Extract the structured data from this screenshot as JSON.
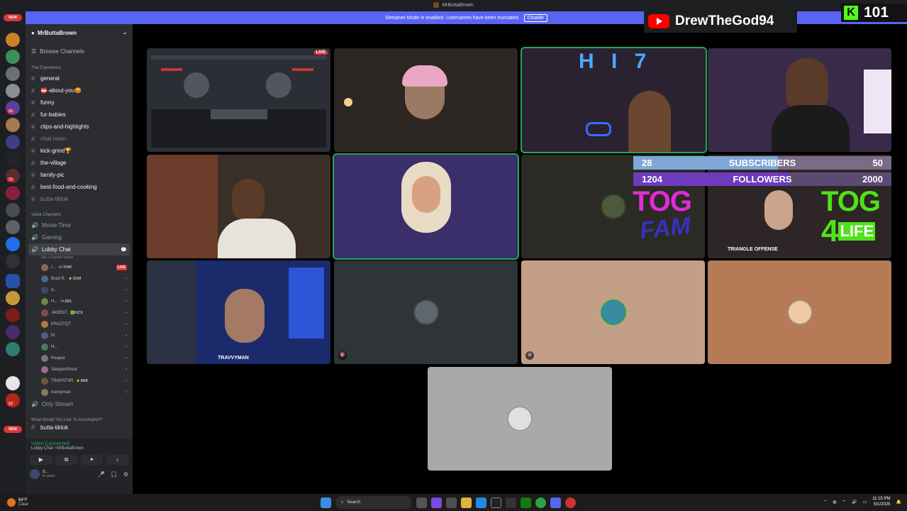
{
  "window": {
    "title": "MrButtaBrown",
    "controls": [
      "▭",
      "—",
      "▢",
      "✕"
    ]
  },
  "banner": {
    "text": "Streamer Mode is enabled. Usernames have been truncated.",
    "button": "Disable"
  },
  "guild_rail": {
    "new_badge_top": "NEW",
    "new_badge_bottom": "NEW",
    "counts": [
      "33",
      "71",
      "17"
    ]
  },
  "server": {
    "name": "MrButtaBrown",
    "browse": "Browse Channels"
  },
  "categories": {
    "experience": "The Experience",
    "voice": "Voice Channels",
    "accomplish": "What Would You Like To Accomplish?"
  },
  "text_channels": [
    {
      "name": "general",
      "muted": false
    },
    {
      "name": "📛-about-you😡",
      "muted": false
    },
    {
      "name": "funny",
      "muted": false
    },
    {
      "name": "fur-babies",
      "muted": false
    },
    {
      "name": "clips-and-highlights",
      "muted": false
    },
    {
      "name": "chat-room",
      "muted": true
    },
    {
      "name": "kick-grind🏆",
      "muted": false
    },
    {
      "name": "the-village",
      "muted": false
    },
    {
      "name": "family-pic",
      "muted": false
    },
    {
      "name": "best-food-and-cooking",
      "muted": false
    },
    {
      "name": "butta-tiktok",
      "muted": true
    }
  ],
  "voice_channels": [
    {
      "name": "Movie Time"
    },
    {
      "name": "Gaming"
    },
    {
      "name": "Lobby Chat",
      "status": "Set a channel status"
    }
  ],
  "voice_members": [
    {
      "name": "I...",
      "tag": "🎮THAT",
      "live": "LIVE"
    },
    {
      "name": "Brad R.",
      "tag": "⚡DOM",
      "live": ""
    },
    {
      "name": "d...",
      "tag": "",
      "live": ""
    },
    {
      "name": "H...",
      "tag": "🎮DRL",
      "live": ""
    },
    {
      "name": "J4OENT",
      "tag": "🟩KICK",
      "live": ""
    },
    {
      "name": "KRAZYQT",
      "tag": "",
      "live": ""
    },
    {
      "name": "M...",
      "tag": "",
      "live": ""
    },
    {
      "name": "N...",
      "tag": "",
      "live": ""
    },
    {
      "name": "Reaper",
      "tag": "",
      "live": ""
    },
    {
      "name": "SleeperGhost",
      "tag": "",
      "live": ""
    },
    {
      "name": "TRAPST4R",
      "tag": "⚡BNB",
      "live": ""
    },
    {
      "name": "travvyman",
      "tag": "",
      "live": ""
    }
  ],
  "only_stream": "Only Stream",
  "truncated_channel": "butta-tiktok",
  "voice_panel": {
    "status": "Video Connected",
    "location": "Lobby Chat / MrButtaBrown",
    "user": "d...",
    "user_sub": "In voice"
  },
  "tiles": {
    "live_badge": "LIVE"
  },
  "overlay": {
    "youtube_name": "DrewTheGod94",
    "kick_count": "101",
    "subs": {
      "current": "28",
      "label": "SUBSCRIBERS",
      "goal": "50"
    },
    "followers": {
      "current": "1204",
      "label": "FOLLOWERS",
      "goal": "2000"
    },
    "tog_fam": [
      "TOG",
      "FAM"
    ],
    "tog_life": [
      "TOG",
      "4",
      "LIFE"
    ],
    "cam_caption": "TRIANGLE OFFENSE",
    "stream_caption": "TRAVVYMAN"
  },
  "taskbar": {
    "temp": "64°F",
    "weather": "Clear",
    "search": "Search",
    "time": "11:15 PM",
    "date": "5/1/2025"
  }
}
